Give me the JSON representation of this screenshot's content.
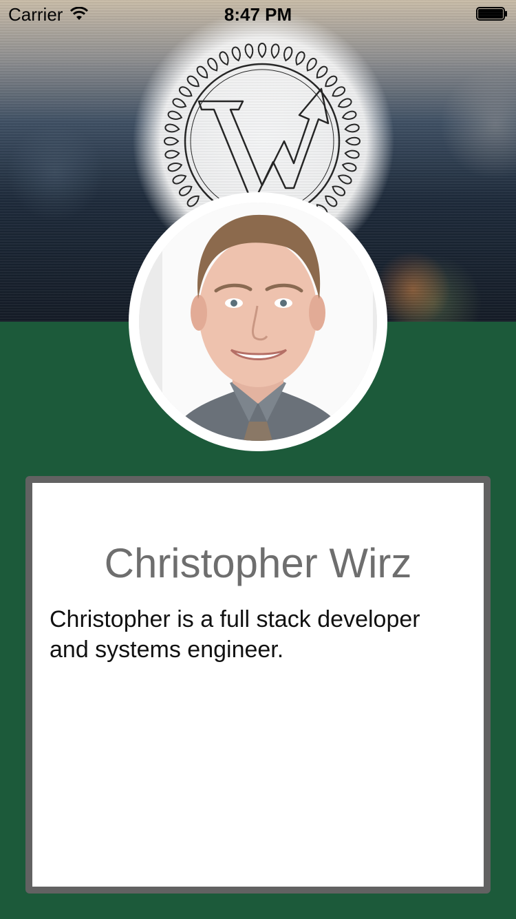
{
  "status_bar": {
    "carrier": "Carrier",
    "time": "8:47 PM",
    "wifi_icon": "wifi-icon",
    "battery_icon": "battery-icon",
    "battery_level": 1.0
  },
  "header": {
    "logo_icon": "wreath-w-arrow-logo",
    "background": "blurred city bokeh"
  },
  "profile": {
    "avatar_icon": "profile-photo",
    "name": "Christopher Wirz",
    "bio": "Christopher is a full stack developer and systems engineer."
  },
  "colors": {
    "page_background": "#1c5a3a",
    "card_border": "#626262",
    "name_text": "#6e6e6e",
    "bio_text": "#111111"
  }
}
